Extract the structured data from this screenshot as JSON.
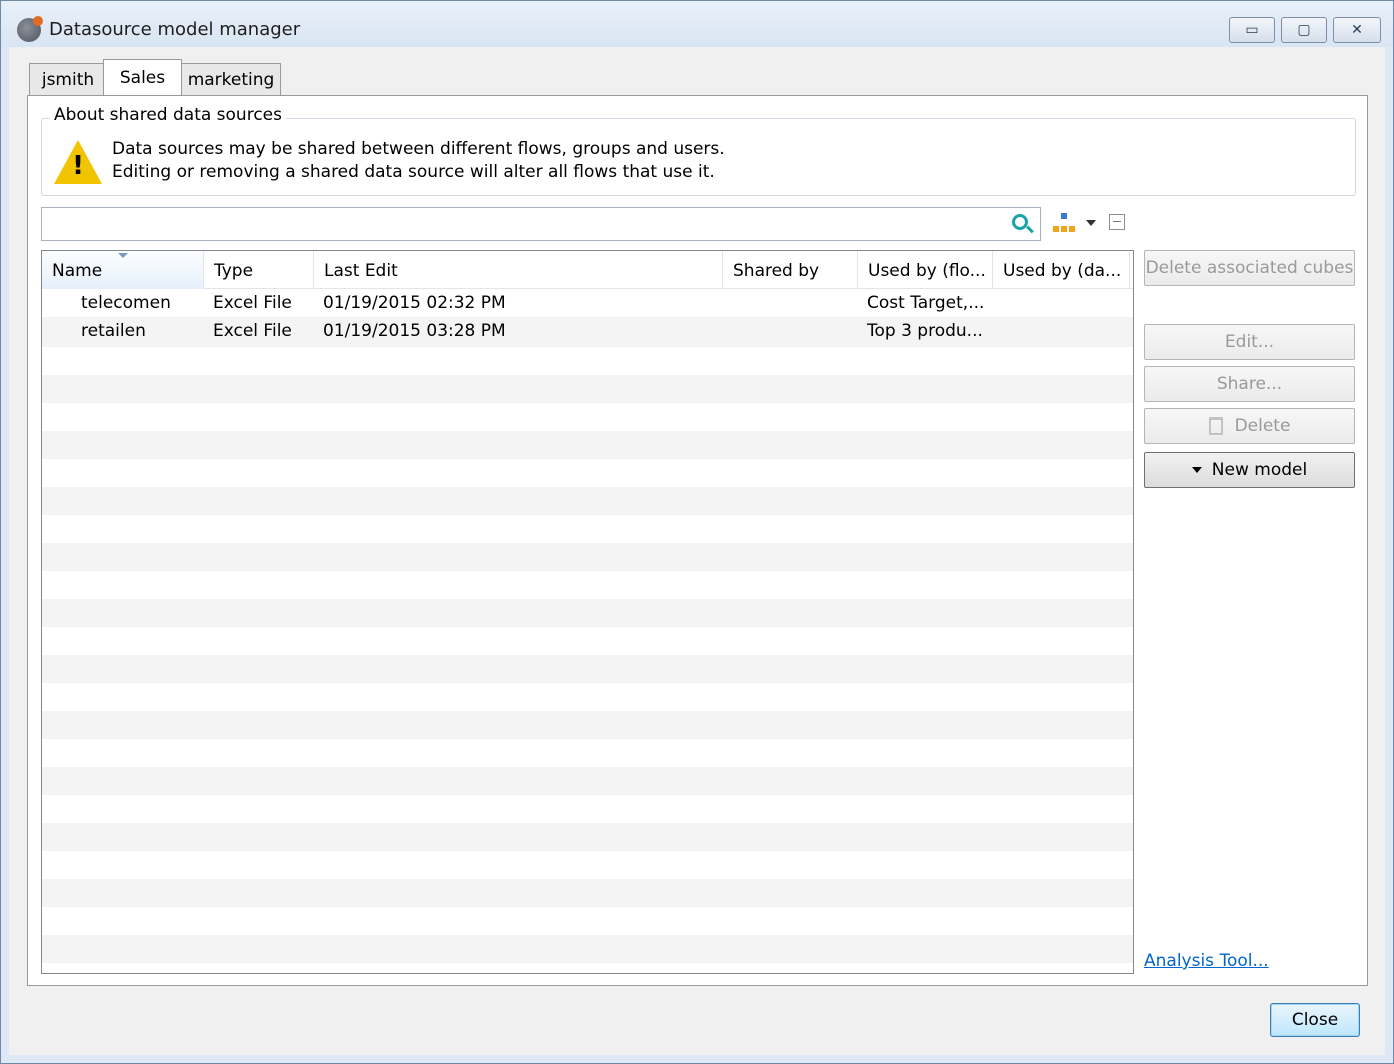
{
  "window": {
    "title": "Datasource model manager",
    "controls": {
      "minimize": "▭",
      "maximize": "▢",
      "close": "✕"
    }
  },
  "tabs": [
    {
      "label": "jsmith",
      "active": false
    },
    {
      "label": "Sales",
      "active": true
    },
    {
      "label": "marketing",
      "active": false
    }
  ],
  "about": {
    "title": "About shared data sources",
    "icon": "warning-icon",
    "line1": "Data sources may be shared between different flows, groups and users.",
    "line2": "Editing or removing a shared data source will alter all flows that use it."
  },
  "search": {
    "value": "",
    "placeholder": ""
  },
  "table": {
    "columns": [
      "Name",
      "Type",
      "Last Edit",
      "Shared by",
      "Used by (flo...",
      "Used by (da..."
    ],
    "sorted_column": "Name",
    "rows": [
      {
        "name": "telecomen",
        "type": "Excel File",
        "last_edit": "01/19/2015 02:32 PM",
        "shared_by": "",
        "used_by_flows": "Cost Target,...",
        "used_by_da": ""
      },
      {
        "name": "retailen",
        "type": "Excel File",
        "last_edit": "01/19/2015 03:28 PM",
        "shared_by": "",
        "used_by_flows": "Top 3 produ...",
        "used_by_da": ""
      }
    ]
  },
  "buttons": {
    "delete_cubes": "Delete associated cubes",
    "edit": "Edit...",
    "share": "Share...",
    "delete": "Delete",
    "new_model": "New model",
    "analysis_tool": "Analysis Tool...",
    "close": "Close"
  },
  "colors": {
    "accent": "#3c7fb1",
    "link": "#0066cc",
    "warning": "#f2c400"
  }
}
